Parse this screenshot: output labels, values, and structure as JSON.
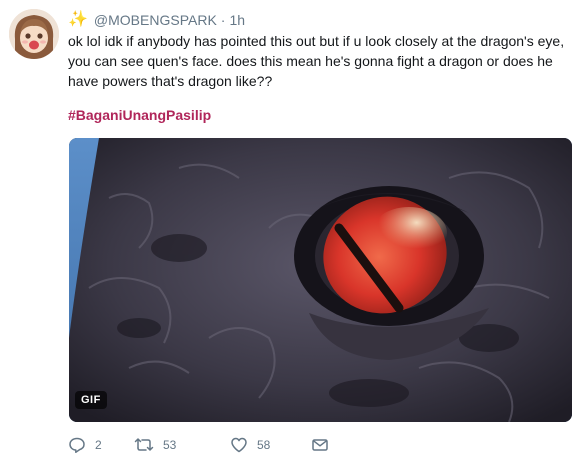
{
  "tweet": {
    "handle": "@MOBENGSPARK",
    "separator": "·",
    "time": "1h",
    "text": "ok lol idk if anybody has pointed this out but if u look closely at the dragon's eye, you can see quen's face. does this mean he's gonna fight a dragon or does he have powers that's dragon like??",
    "hashtag": "#BaganiUnangPasilip",
    "media": {
      "badge": "GIF"
    },
    "icons": {
      "name_decoration": "sparkles-icon",
      "reply": "reply-icon",
      "retweet": "retweet-icon",
      "like": "like-icon",
      "message": "direct-message-icon"
    },
    "actions": {
      "replies": "2",
      "retweets": "53",
      "likes": "58"
    },
    "colors": {
      "hashtag": "#b0265a",
      "meta_text": "#657786",
      "body_text": "#14171a",
      "sparkle": "#f5b70e"
    }
  }
}
